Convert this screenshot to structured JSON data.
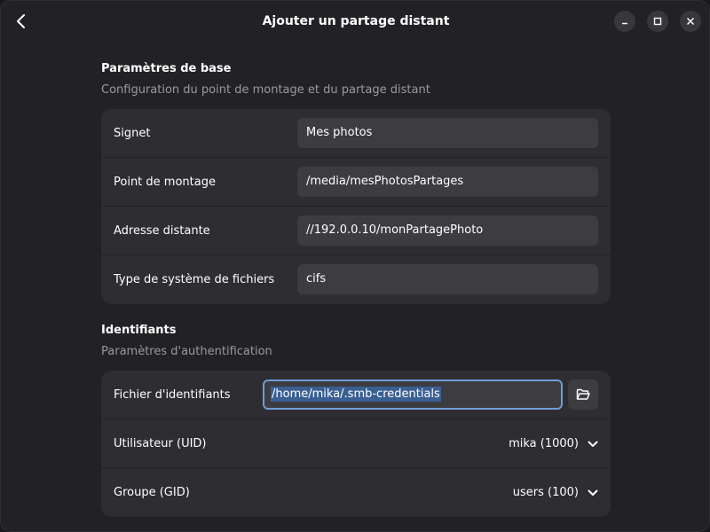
{
  "window": {
    "title": "Ajouter un partage distant"
  },
  "basic": {
    "title": "Paramètres de base",
    "subtitle": "Configuration du point de montage et du partage distant",
    "rows": [
      {
        "label": "Signet",
        "value": "Mes photos"
      },
      {
        "label": "Point de montage",
        "value": "/media/mesPhotosPartages"
      },
      {
        "label": "Adresse distante",
        "value": "//192.0.0.10/monPartagePhoto"
      },
      {
        "label": "Type de système de fichiers",
        "value": "cifs"
      }
    ]
  },
  "credentials": {
    "title": "Identifiants",
    "subtitle": "Paramètres d'authentification",
    "file_label": "Fichier d'identifiants",
    "file_value": "/home/mika/.smb-credentials",
    "user_label": "Utilisateur (UID)",
    "user_value": "mika (1000)",
    "group_label": "Groupe (GID)",
    "group_value": "users (100)"
  },
  "colors": {
    "accent": "#6e9ed9",
    "selection": "#3a5f93",
    "card": "#2e2e32",
    "window": "#222226"
  },
  "icons": {
    "back": "go-previous-icon",
    "minimize": "window-minimize-icon",
    "maximize": "window-maximize-icon",
    "close": "window-close-icon",
    "folder": "folder-open-icon",
    "dropdown": "chevron-down-icon"
  }
}
